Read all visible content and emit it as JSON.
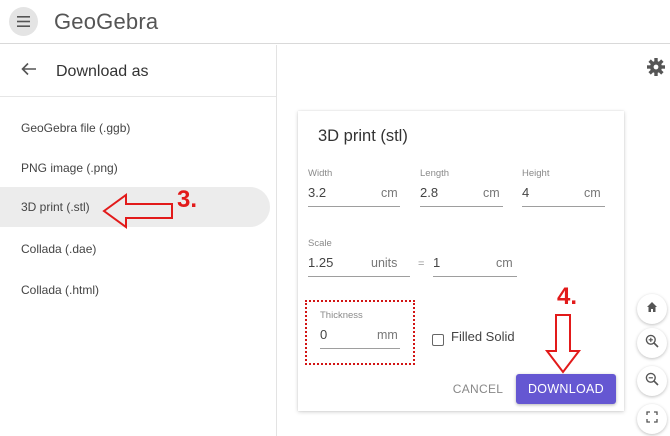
{
  "app": {
    "logo_text": "GeoGebra"
  },
  "sidebar": {
    "title": "Download as",
    "items": [
      {
        "label": "GeoGebra file (.ggb)",
        "selected": false
      },
      {
        "label": "PNG image (.png)",
        "selected": false
      },
      {
        "label": "3D print (.stl)",
        "selected": true
      },
      {
        "label": "Collada (.dae)",
        "selected": false
      },
      {
        "label": "Collada (.html)",
        "selected": false
      }
    ]
  },
  "dialog": {
    "title": "3D print (stl)",
    "width": {
      "label": "Width",
      "value": "3.2",
      "unit": "cm"
    },
    "length": {
      "label": "Length",
      "value": "2.8",
      "unit": "cm"
    },
    "height": {
      "label": "Height",
      "value": "4",
      "unit": "cm"
    },
    "scale": {
      "label": "Scale",
      "value": "1.25",
      "unit": "units",
      "equals": "=",
      "cm_value": "1",
      "cm_unit": "cm"
    },
    "thickness": {
      "label": "Thickness",
      "value": "0",
      "unit": "mm"
    },
    "filled_solid": {
      "label": "Filled Solid",
      "checked": false
    },
    "cancel_label": "CANCEL",
    "download_label": "DOWNLOAD"
  },
  "annotations": {
    "step3": "3.",
    "step4": "4."
  },
  "colors": {
    "accent": "#6557d2",
    "annotation": "#e21a1a"
  },
  "icons": {
    "menu": "menu-icon",
    "back": "arrow-left-icon",
    "settings": "gear-icon",
    "home": "home-icon",
    "zoom_in": "zoom-in-icon",
    "zoom_out": "zoom-out-icon",
    "fullscreen": "fullscreen-icon"
  }
}
